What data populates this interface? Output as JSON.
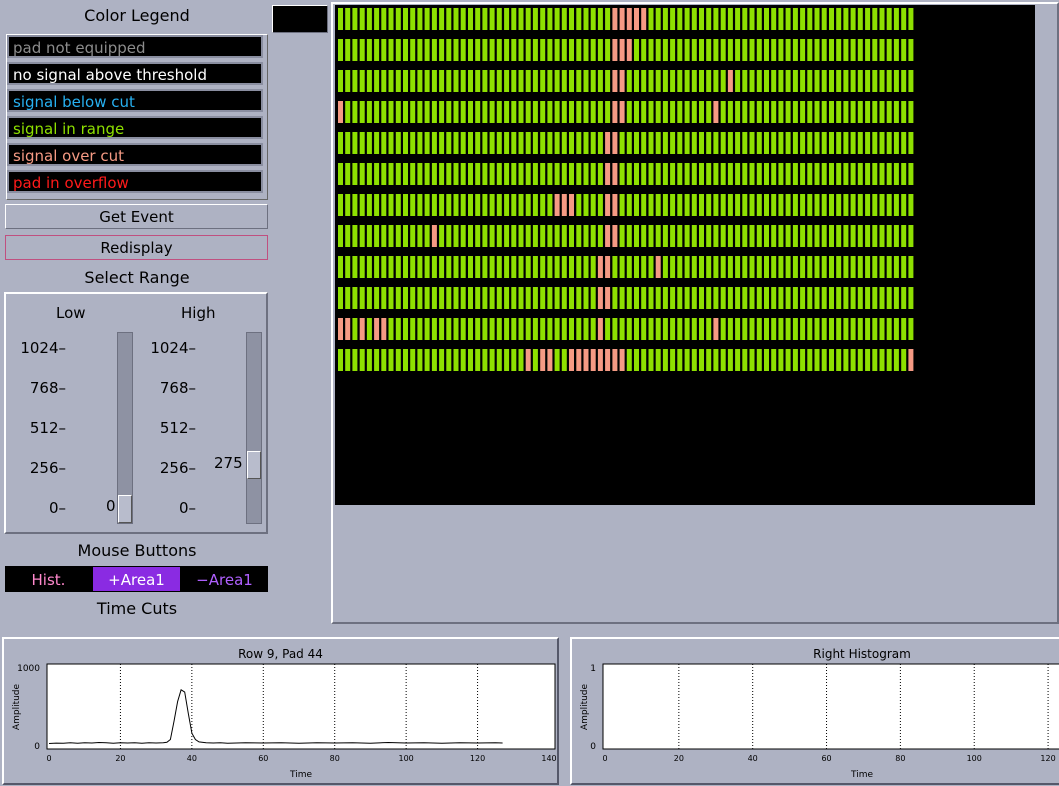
{
  "legend": {
    "title": "Color Legend",
    "items": [
      {
        "label": "pad not equipped",
        "color": "#8c8c8c"
      },
      {
        "label": "no signal above threshold",
        "color": "#ffffff"
      },
      {
        "label": "signal below cut",
        "color": "#27b0f0"
      },
      {
        "label": "signal in range",
        "color": "#8ee000"
      },
      {
        "label": "signal over cut",
        "color": "#f59a84"
      },
      {
        "label": "pad in overflow",
        "color": "#ff1a1a"
      }
    ]
  },
  "buttons": {
    "get_event": "Get Event",
    "redisplay": "Redisplay"
  },
  "range": {
    "title": "Select Range",
    "low_label": "Low",
    "high_label": "High",
    "ticks": [
      "1024",
      "768",
      "512",
      "256",
      "0"
    ],
    "low_value": "0",
    "high_value": "275",
    "max": 1024
  },
  "mouse": {
    "title": "Mouse Buttons",
    "buttons": [
      {
        "label": "Hist.",
        "color": "#ff88cc",
        "bg": "#000000"
      },
      {
        "label": "+Area1",
        "color": "#ffffff",
        "bg": "#8a2be2"
      },
      {
        "label": "−Area1",
        "color": "#b060ff",
        "bg": "#000000"
      }
    ]
  },
  "time_cuts": {
    "title": "Time Cuts"
  },
  "pads": {
    "rows": 12,
    "cols": 80,
    "colors": {
      "range": "#8ee000",
      "over": "#f59a84"
    },
    "over_cut": [
      [
        38,
        39,
        40,
        41,
        42
      ],
      [
        38,
        39,
        40
      ],
      [
        38,
        39,
        54
      ],
      [
        0,
        38,
        39,
        52
      ],
      [
        37,
        38
      ],
      [
        37,
        38
      ],
      [
        30,
        31,
        32,
        37,
        38
      ],
      [
        13,
        37,
        38
      ],
      [
        36,
        37,
        44
      ],
      [
        36,
        37
      ],
      [
        0,
        1,
        3,
        5,
        6,
        36,
        52
      ],
      [
        26,
        28,
        29,
        32,
        33,
        34,
        35,
        36,
        37,
        38,
        39,
        79
      ]
    ]
  },
  "histograms": {
    "left": {
      "title": "Row 9, Pad 44",
      "ylabel": "Amplitude",
      "xlabel": "Time",
      "yticks": [
        "1000",
        "0"
      ],
      "xticks": [
        "0",
        "20",
        "40",
        "60",
        "80",
        "100",
        "120",
        "140"
      ]
    },
    "right": {
      "title": "Right Histogram",
      "ylabel": "Amplitude",
      "xlabel": "Time",
      "yticks": [
        "1",
        "0"
      ],
      "xticks": [
        "0",
        "20",
        "40",
        "60",
        "80",
        "100",
        "120"
      ]
    }
  },
  "chart_data": [
    {
      "type": "line",
      "title": "Row 9, Pad 44",
      "xlabel": "Time",
      "ylabel": "Amplitude",
      "xlim": [
        0,
        140
      ],
      "ylim": [
        0,
        1000
      ],
      "x": [
        0,
        2,
        4,
        6,
        8,
        10,
        12,
        14,
        16,
        18,
        20,
        22,
        24,
        26,
        28,
        30,
        32,
        33,
        34,
        35,
        36,
        37,
        38,
        39,
        40,
        41,
        42,
        44,
        46,
        48,
        50,
        55,
        60,
        65,
        70,
        75,
        80,
        85,
        90,
        95,
        100,
        105,
        110,
        115,
        120,
        125,
        127
      ],
      "y": [
        70,
        75,
        72,
        78,
        74,
        80,
        76,
        82,
        78,
        74,
        80,
        76,
        78,
        74,
        80,
        76,
        78,
        85,
        120,
        350,
        600,
        750,
        720,
        450,
        200,
        120,
        90,
        80,
        76,
        78,
        74,
        80,
        76,
        78,
        74,
        80,
        76,
        78,
        74,
        82,
        76,
        80,
        74,
        78,
        76,
        80,
        76
      ]
    },
    {
      "type": "line",
      "title": "Right Histogram",
      "xlabel": "Time",
      "ylabel": "Amplitude",
      "xlim": [
        0,
        130
      ],
      "ylim": [
        0,
        1
      ],
      "x": [],
      "y": []
    }
  ]
}
